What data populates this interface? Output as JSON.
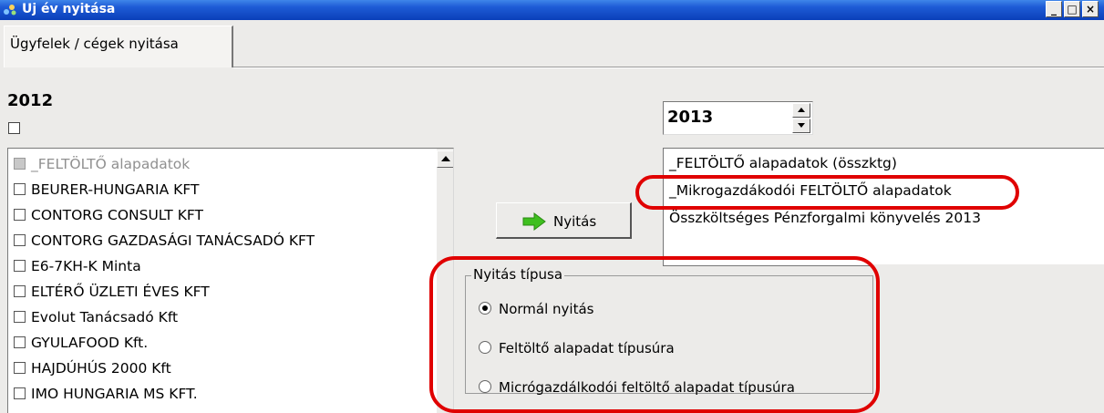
{
  "window": {
    "title": "Uj év nyitása",
    "controls": {
      "minimize": "_",
      "maximize": "□",
      "close": "×"
    }
  },
  "tabs": [
    {
      "label": "Ügyfelek / cégek nyitása",
      "active": true
    }
  ],
  "left_panel": {
    "year": "2012",
    "select_all_checked": false,
    "items": [
      {
        "label": "_FELTÖLTŐ alapadatok",
        "checked": false,
        "disabled": true
      },
      {
        "label": "BEURER-HUNGARIA KFT",
        "checked": false,
        "disabled": false
      },
      {
        "label": "CONTORG CONSULT KFT",
        "checked": false,
        "disabled": false
      },
      {
        "label": "CONTORG GAZDASÁGI TANÁCSADÓ KFT",
        "checked": false,
        "disabled": false
      },
      {
        "label": "E6-7KH-K Minta",
        "checked": false,
        "disabled": false
      },
      {
        "label": "ELTÉRŐ ÜZLETI ÉVES KFT",
        "checked": false,
        "disabled": false
      },
      {
        "label": "Evolut Tanácsadó Kft",
        "checked": false,
        "disabled": false
      },
      {
        "label": "GYULAFOOD Kft.",
        "checked": false,
        "disabled": false
      },
      {
        "label": "HAJDÚHÚS 2000 Kft",
        "checked": false,
        "disabled": false
      },
      {
        "label": "IMO HUNGARIA MS KFT.",
        "checked": false,
        "disabled": false
      }
    ]
  },
  "open_button": {
    "label": "Nyitás",
    "icon": "green-arrow-right-icon"
  },
  "right_panel": {
    "year": "2013",
    "items": [
      "_FELTÖLTŐ alapadatok (összktg)",
      "_Mikrogazdákodói FELTÖLTŐ alapadatok",
      "Összköltséges Pénzforgalmi könyvelés 2013"
    ]
  },
  "opening_type": {
    "legend": "Nyitás típusa",
    "options": [
      {
        "label": "Normál nyitás",
        "selected": true
      },
      {
        "label": "Feltöltő alapadat típusúra",
        "selected": false
      },
      {
        "label": "Micrógazdálkodói feltöltő alapadat típusúra",
        "selected": false
      }
    ]
  },
  "colors": {
    "highlight": "#e00000",
    "titlebar": "#1e5bd6",
    "window_bg": "#ecebe9",
    "arrow": "#3fbf1f"
  }
}
